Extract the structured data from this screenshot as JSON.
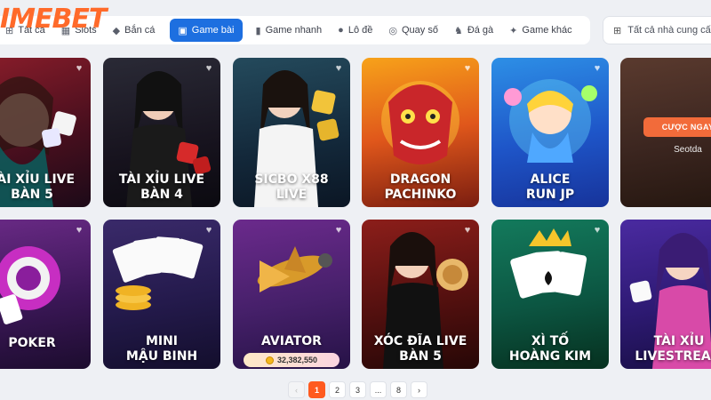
{
  "brand": {
    "logo_text": "IMEBET"
  },
  "nav": {
    "tabs": [
      {
        "label": "Tất cả",
        "icon": "grid-icon"
      },
      {
        "label": "Slots",
        "icon": "slot-icon"
      },
      {
        "label": "Bắn cá",
        "icon": "fish-icon"
      },
      {
        "label": "Game bài",
        "icon": "card-icon",
        "active": true
      },
      {
        "label": "Game nhanh",
        "icon": "bar-chart-icon"
      },
      {
        "label": "Lô đề",
        "icon": "ball-icon"
      },
      {
        "label": "Quay số",
        "icon": "dial-icon"
      },
      {
        "label": "Đá gà",
        "icon": "rooster-icon"
      },
      {
        "label": "Game khác",
        "icon": "puzzle-icon"
      }
    ],
    "provider_filter": "Tất cả nhà cung cấp"
  },
  "games": [
    {
      "line1": "TÀI XỈU LIVE",
      "line2": "BÀN 5"
    },
    {
      "line1": "TÀI XỈU LIVE",
      "line2": "BÀN 4"
    },
    {
      "line1": "SICBO X88",
      "line2": "LIVE"
    },
    {
      "line1": "DRAGON",
      "line2": "PACHINKO"
    },
    {
      "line1": "ALICE",
      "line2": "RUN JP"
    },
    {
      "badge": "CƯỢC NGAY",
      "name": "Seotda"
    },
    {
      "line1": "POKER"
    },
    {
      "line1": "MINI",
      "line2": "MẬU BINH"
    },
    {
      "line1": "AVIATOR",
      "jackpot": "32,382,550"
    },
    {
      "line1": "XÓC ĐĨA LIVE",
      "line2": "BÀN 5"
    },
    {
      "line1": "XÌ TỐ",
      "line2": "HOÀNG KIM"
    },
    {
      "line1": "TÀI XỈU",
      "line2": "LIVESTREAM"
    }
  ],
  "pagination": {
    "prev": "‹",
    "pages": [
      "1",
      "2",
      "3",
      "...",
      "8"
    ],
    "next": "›",
    "current": "1"
  },
  "colors": {
    "accent": "#1d6fe0",
    "brand": "#ff6a2a",
    "page_active": "#ff5a1f"
  }
}
